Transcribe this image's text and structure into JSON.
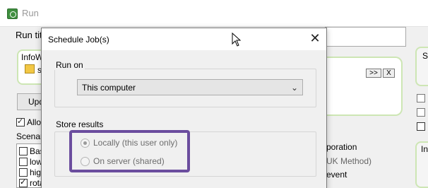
{
  "background_window": {
    "title": "Run",
    "run_title_label": "Run titl",
    "infobox_label": "InfoW",
    "info_icon_text": "s",
    "update_label": "Upd",
    "allow_label": "Allo",
    "scenarios_label": "Scenari",
    "scenarios": [
      {
        "label": "Bas",
        "checked": false
      },
      {
        "label": "low",
        "checked": false
      },
      {
        "label": "high",
        "checked": false
      },
      {
        "label": "rota",
        "checked": true
      }
    ],
    "expand_label": ">>",
    "close_label": "X",
    "side_label": "Si",
    "right_box_label": "In",
    "corporation_text": "poration",
    "uk_method_text": "UK Method)",
    "event_text": "event"
  },
  "dialog": {
    "title": "Schedule Job(s)",
    "close_glyph": "✕",
    "run_on": {
      "label": "Run on",
      "selected": "This computer",
      "chevron": "⌄"
    },
    "store_results": {
      "label": "Store results",
      "options": [
        {
          "label": "Locally (this user only)",
          "selected": true,
          "enabled": false
        },
        {
          "label": "On server (shared)",
          "selected": false,
          "enabled": false
        }
      ]
    }
  },
  "colors": {
    "highlight": "#6b4d9e",
    "group_accent": "#cde6b4"
  }
}
